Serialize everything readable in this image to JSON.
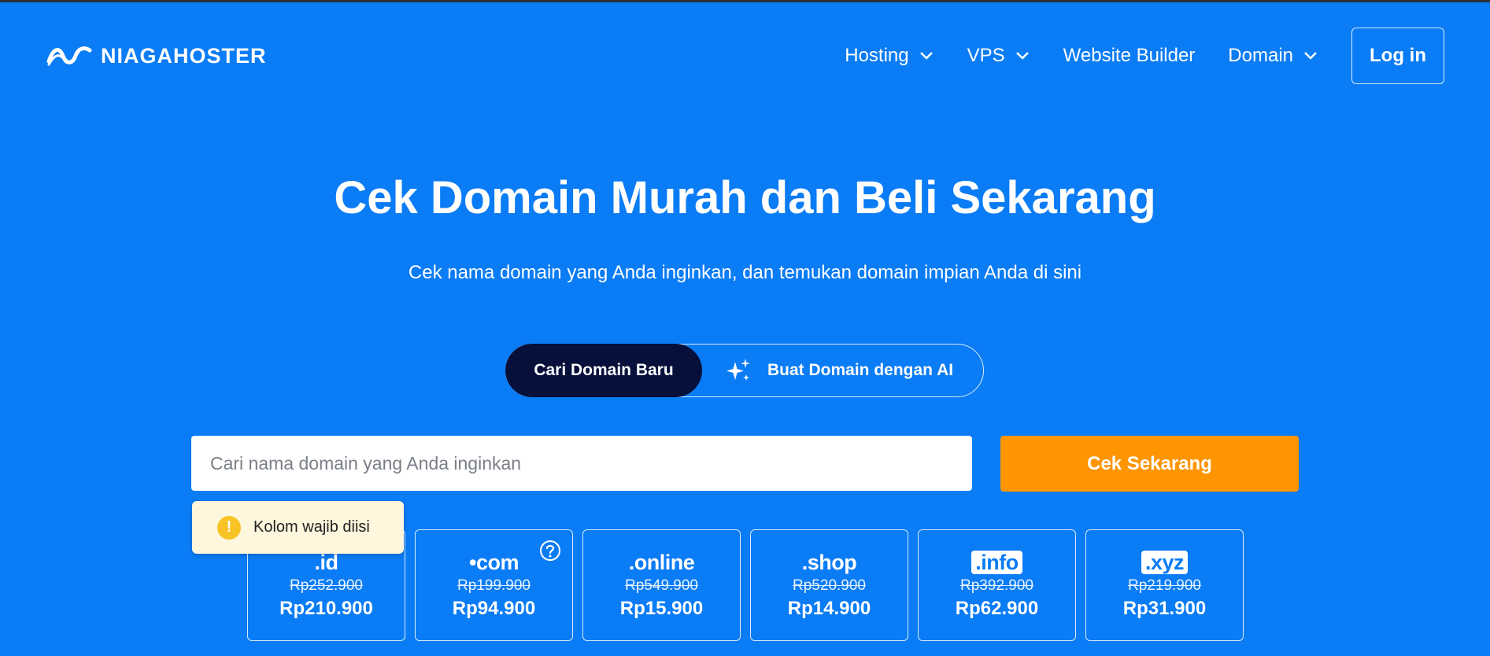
{
  "header": {
    "logo_text": "NIAGAHOSTER",
    "nav": [
      {
        "label": "Hosting",
        "has_dropdown": true
      },
      {
        "label": "VPS",
        "has_dropdown": true
      },
      {
        "label": "Website Builder",
        "has_dropdown": false
      },
      {
        "label": "Domain",
        "has_dropdown": true
      }
    ],
    "login_label": "Log in"
  },
  "hero": {
    "title": "Cek Domain Murah dan Beli Sekarang",
    "subtitle": "Cek nama domain yang Anda inginkan, dan temukan domain impian Anda di sini"
  },
  "mode_toggle": {
    "active_label": "Cari Domain Baru",
    "ai_label": "Buat Domain dengan AI",
    "ai_icon": "sparkles-icon"
  },
  "search": {
    "placeholder": "Cari nama domain yang Anda inginkan",
    "value": "",
    "button_label": "Cek Sekarang"
  },
  "validation": {
    "icon": "warning-icon",
    "message": "Kolom wajib diisi"
  },
  "domains": [
    {
      "tld": ".id",
      "old_price": "Rp252.900",
      "price": "Rp210.900",
      "boxed": false,
      "help": false
    },
    {
      "tld": "•com",
      "old_price": "Rp199.900",
      "price": "Rp94.900",
      "boxed": false,
      "help": true
    },
    {
      "tld": ".online",
      "old_price": "Rp549.900",
      "price": "Rp15.900",
      "boxed": false,
      "help": false
    },
    {
      "tld": ".shop",
      "old_price": "Rp520.900",
      "price": "Rp14.900",
      "boxed": false,
      "help": false
    },
    {
      "tld": ".info",
      "old_price": "Rp392.900",
      "price": "Rp62.900",
      "boxed": true,
      "help": false
    },
    {
      "tld": ".xyz",
      "old_price": "Rp219.900",
      "price": "Rp31.900",
      "boxed": true,
      "help": false
    }
  ],
  "colors": {
    "background": "#0a7cf5",
    "toggle_active": "#06103b",
    "cta": "#ff9500",
    "tooltip_bg": "#fef6dd",
    "warning": "#f7c325"
  }
}
